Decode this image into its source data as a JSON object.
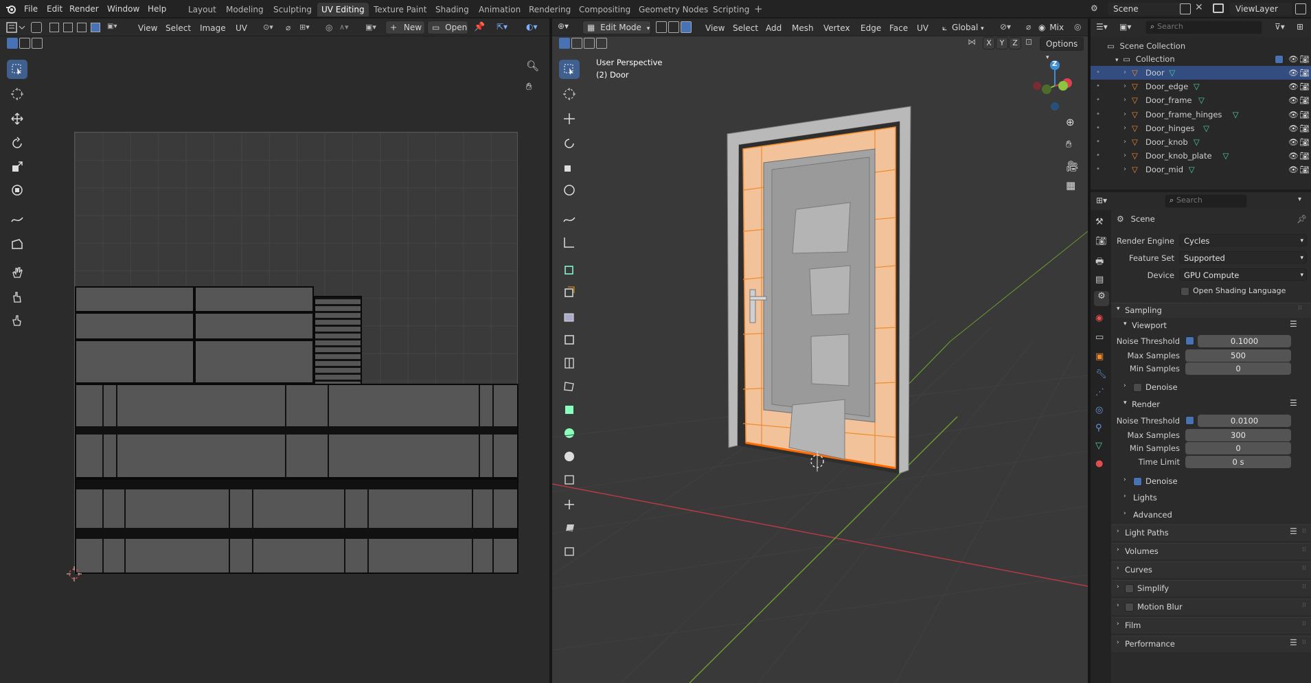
{
  "topbar": {
    "menus": [
      "File",
      "Edit",
      "Render",
      "Window",
      "Help"
    ],
    "workspaces": [
      "Layout",
      "Modeling",
      "Sculpting",
      "UV Editing",
      "Texture Paint",
      "Shading",
      "Animation",
      "Rendering",
      "Compositing",
      "Geometry Nodes",
      "Scripting"
    ],
    "active_workspace": "UV Editing",
    "scene": "Scene",
    "view_layer": "ViewLayer"
  },
  "uv_editor": {
    "menus": [
      "View",
      "Select",
      "Image",
      "UV"
    ],
    "new_label": "New",
    "open_label": "Open"
  },
  "viewport": {
    "mode": "Edit Mode",
    "menus": [
      "View",
      "Select",
      "Add",
      "Mesh",
      "Vertex",
      "Edge",
      "Face",
      "UV"
    ],
    "transform_orientation": "Global",
    "shading_mix": "Mix",
    "axes": [
      "X",
      "Y",
      "Z"
    ],
    "options_label": "Options",
    "overlay_title": "User Perspective",
    "overlay_object": "(2) Door",
    "gizmo_z": "Z"
  },
  "outliner": {
    "search_placeholder": "Search",
    "scene_collection": "Scene Collection",
    "collection": "Collection",
    "objects": [
      "Door",
      "Door_edge",
      "Door_frame",
      "Door_frame_hinges",
      "Door_hinges",
      "Door_knob",
      "Door_knob_plate",
      "Door_mid"
    ],
    "selected": "Door"
  },
  "properties": {
    "search_placeholder": "Search",
    "context": "Scene",
    "render_engine_label": "Render Engine",
    "render_engine": "Cycles",
    "feature_set_label": "Feature Set",
    "feature_set": "Supported",
    "device_label": "Device",
    "device": "GPU Compute",
    "osl_label": "Open Shading Language",
    "sampling": "Sampling",
    "viewport": "Viewport",
    "noise_threshold_label": "Noise Threshold",
    "vp_noise": "0.1000",
    "max_samples_label": "Max Samples",
    "vp_max": "500",
    "min_samples_label": "Min Samples",
    "vp_min": "0",
    "denoise_label": "Denoise",
    "render": "Render",
    "r_noise": "0.0100",
    "r_max": "300",
    "r_min": "0",
    "time_limit_label": "Time Limit",
    "r_time": "0 s",
    "lights": "Lights",
    "advanced": "Advanced",
    "panels": [
      "Light Paths",
      "Volumes",
      "Curves",
      "Simplify",
      "Motion Blur",
      "Film",
      "Performance"
    ]
  },
  "colors": {
    "accent": "#4772b3",
    "selection_orange": "#f08a2c",
    "x_axis": "#d9434f",
    "y_axis": "#8cc53f",
    "z_axis": "#3f8fd8"
  }
}
